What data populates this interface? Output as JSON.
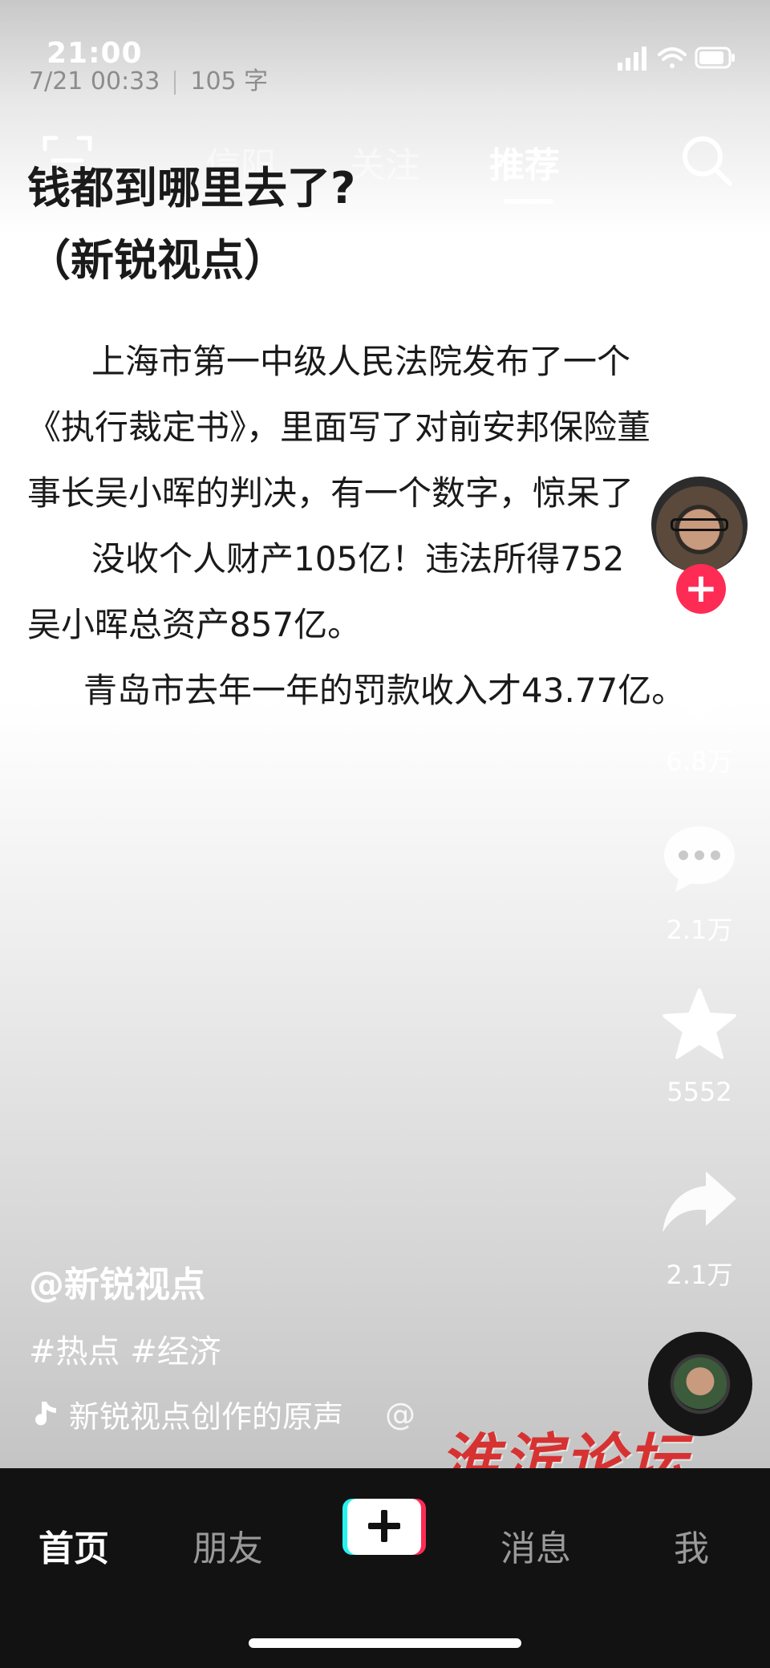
{
  "status_bar": {
    "time": "21:00"
  },
  "note_meta": {
    "datetime": "7/21 00:33",
    "char_count": "105 字"
  },
  "top_nav": {
    "tabs": [
      {
        "label": "信阳"
      },
      {
        "label": "关注"
      },
      {
        "label": "推荐",
        "active": true
      }
    ]
  },
  "article": {
    "title_line1": "钱都到哪里去了?",
    "title_line2": "（新锐视点）",
    "lines": [
      "上海市第一中级人民法院发布了一个",
      "《执行裁定书》，里面写了对前安邦保险董",
      "事长吴小晖的判决，有一个数字，惊呆了",
      "没收个人财产105亿！违法所得752",
      "吴小晖总资产857亿。",
      "青岛市去年一年的罚款收入才43.77亿。"
    ]
  },
  "rail": {
    "likes": "6.8万",
    "comments": "2.1万",
    "favorites": "5552",
    "shares": "2.1万"
  },
  "video_info": {
    "author": "@新锐视点",
    "hashtags": "#热点 #经济",
    "music": "新锐视点创作的原声",
    "music_suffix": "@"
  },
  "watermark": "淮滨论坛",
  "bottom_tabs": {
    "home": "首页",
    "friends": "朋友",
    "messages": "消息",
    "me": "我"
  },
  "colors": {
    "accent_pink": "#fe2c55",
    "accent_cyan": "#25f4ee",
    "tabbar_bg": "#121212",
    "watermark_red": "#d73232"
  }
}
